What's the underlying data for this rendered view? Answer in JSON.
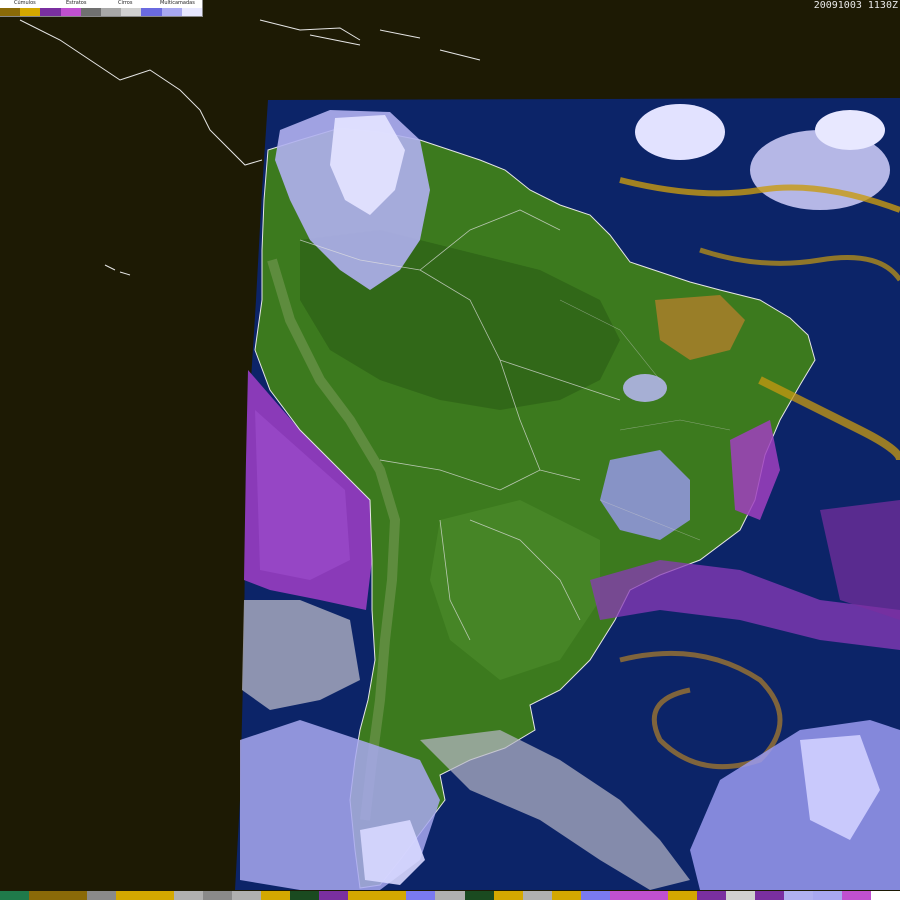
{
  "timestamp": "20091003  1130Z",
  "legend": {
    "groups": [
      {
        "label": "Cúmulos",
        "colors": [
          "#8a6a08",
          "#d4a800"
        ]
      },
      {
        "label": "Estratos",
        "colors": [
          "#7a2fa0",
          "#c050d0"
        ]
      },
      {
        "label": "Cirros",
        "colors": [
          "#707070",
          "#a8a8a8",
          "#d0d0d0"
        ]
      },
      {
        "label": "Multicamadas",
        "colors": [
          "#6a6ae0",
          "#a8a8f0",
          "#e8e8ff"
        ]
      }
    ]
  },
  "colors": {
    "background": "#1d1a04",
    "ocean": "#0c2468",
    "land": "#3c7a1e",
    "land_dark": "#2a5a14",
    "land_light": "#5a8a3a",
    "coastline": "#e6e6e6",
    "cumulus": "#c89a10",
    "cumulus_dark": "#8a6a08",
    "stratus": "#8a3ab8",
    "cirrus": "#b8b8c8",
    "multilayer": "#9a9af0",
    "multilayer_bright": "#d8d8ff"
  },
  "bottom_scale": [
    "#1f7a4a",
    "#8a6a08",
    "#8a6a08",
    "#8a8a8a",
    "#d4a800",
    "#d4a800",
    "#b0b0b0",
    "#8a8a8a",
    "#b0b0b0",
    "#d4a800",
    "#1a4a20",
    "#7a2fa0",
    "#d4a800",
    "#d4a800",
    "#7a7af0",
    "#b0b0b0",
    "#1a4a20",
    "#d4a800",
    "#b0b0b0",
    "#d4a800",
    "#7a7af0",
    "#c050d0",
    "#c050d0",
    "#d4a800",
    "#7a2fa0",
    "#d0d0d0",
    "#7a2fa0",
    "#b0b0f0",
    "#a8a8f0",
    "#c050d0",
    "#ffffff"
  ]
}
